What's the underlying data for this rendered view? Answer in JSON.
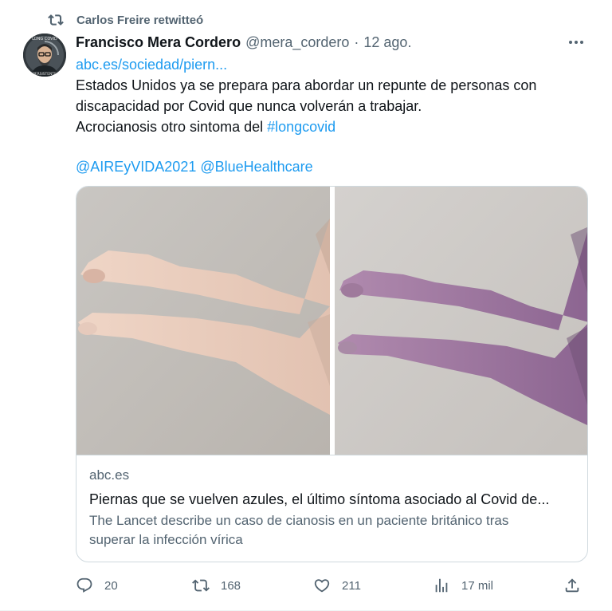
{
  "retweet": {
    "label": "Carlos Freire retwitteó",
    "icon": "retweet-icon"
  },
  "author": {
    "name": "Francisco Mera Cordero",
    "handle": "@mera_cordero",
    "separator": "·",
    "time": "12 ago.",
    "avatar_icon": "avatar",
    "avatar_text_top": "LONG COVID",
    "avatar_text_bottom": "PERSISTENTE"
  },
  "tweet": {
    "link": "abc.es/sociedad/piern...",
    "line1": "Estados Unidos ya se prepara para abordar un repunte de personas con",
    "line2": "discapacidad por Covid que nunca volverán a trabajar.",
    "line3_text": "Acrocianosis otro sintoma del ",
    "hashtag": "#longcovid",
    "mentions": "@AIREyVIDA2021 @BlueHealthcare"
  },
  "card": {
    "domain": "abc.es",
    "title": "Piernas que se vuelven azules, el último síntoma asociado al Covid de...",
    "description_line1": "The Lancet describe un caso de cianosis en un paciente británico tras",
    "description_line2": "superar la infección vírica"
  },
  "actions": {
    "replies": "20",
    "retweets": "168",
    "likes": "211",
    "views": "17 mil"
  },
  "colors": {
    "accent": "#1d9bf0",
    "secondary_text": "#536471",
    "border": "#cfd9de"
  }
}
